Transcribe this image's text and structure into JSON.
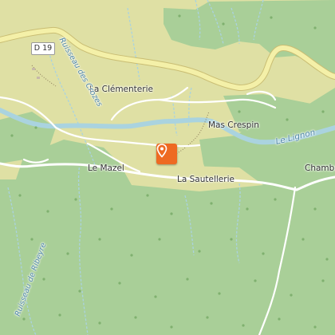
{
  "map": {
    "roads": {
      "d19": "D 19"
    },
    "places": {
      "la_clementerie": "La Clémenterie",
      "mas_crespin": "Mas Crespin",
      "le_mazel": "Le Mazel",
      "la_sautellerie": "La Sautellerie",
      "chambon": "Chambo"
    },
    "waterways": {
      "lignon": "Le Lignon",
      "ruisseau_crozes": "Ruisseau des Crozes",
      "ruisseau_ribeyre": "Ruisseau de Ribeyre"
    },
    "marker": {
      "icon": "map-pin-icon",
      "color": "#ee6a22"
    },
    "colors": {
      "forest": "#a9cf98",
      "farmland": "#dfe0a4",
      "river": "#aad3df",
      "main_road": "#f4f0a8",
      "main_road_casing": "#c9bd73",
      "road": "#ffffff"
    }
  }
}
